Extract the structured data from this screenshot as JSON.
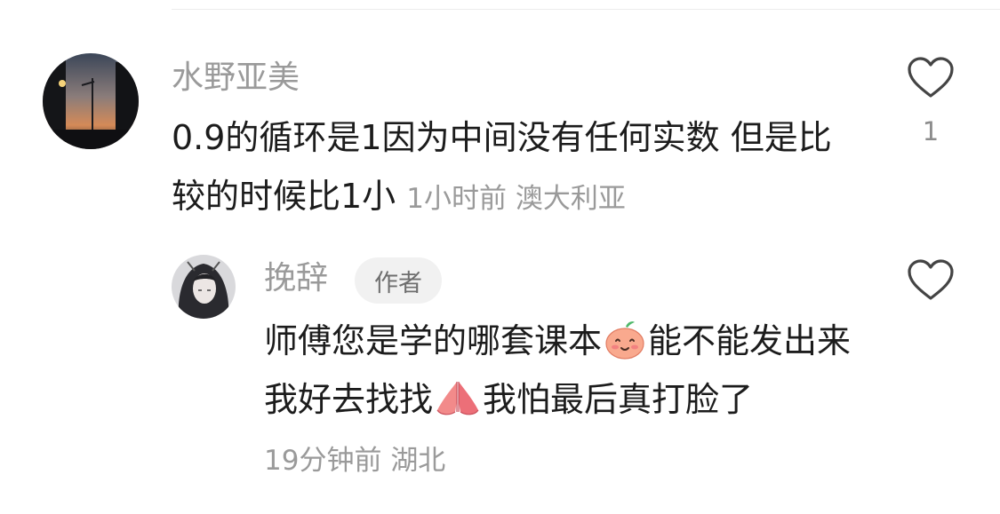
{
  "comments": [
    {
      "username": "水野亚美",
      "avatar_icon": "sunset-street-avatar",
      "text": "0.9的循环是1因为中间没有任何实数 但是比较的时候比1小",
      "time": "1小时前",
      "location": "澳大利亚",
      "like_icon": "heart-outline-icon",
      "likes": "1"
    },
    {
      "username": "挽辞",
      "avatar_icon": "anime-girl-avatar",
      "badge": "作者",
      "text_part1": "师傅您是学的哪套课本",
      "emoji1": "peach-smile-emoji",
      "text_part2": "能不能发出来我好去找找",
      "emoji2": "pray-hands-emoji",
      "text_part3": "我怕最后真打脸了",
      "time": "19分钟前",
      "location": "湖北",
      "like_icon": "heart-outline-icon"
    }
  ],
  "colors": {
    "text": "#1c1c1c",
    "secondary": "#9a9a9a",
    "badge_bg": "#f1f1f1",
    "divider": "#ececec"
  }
}
